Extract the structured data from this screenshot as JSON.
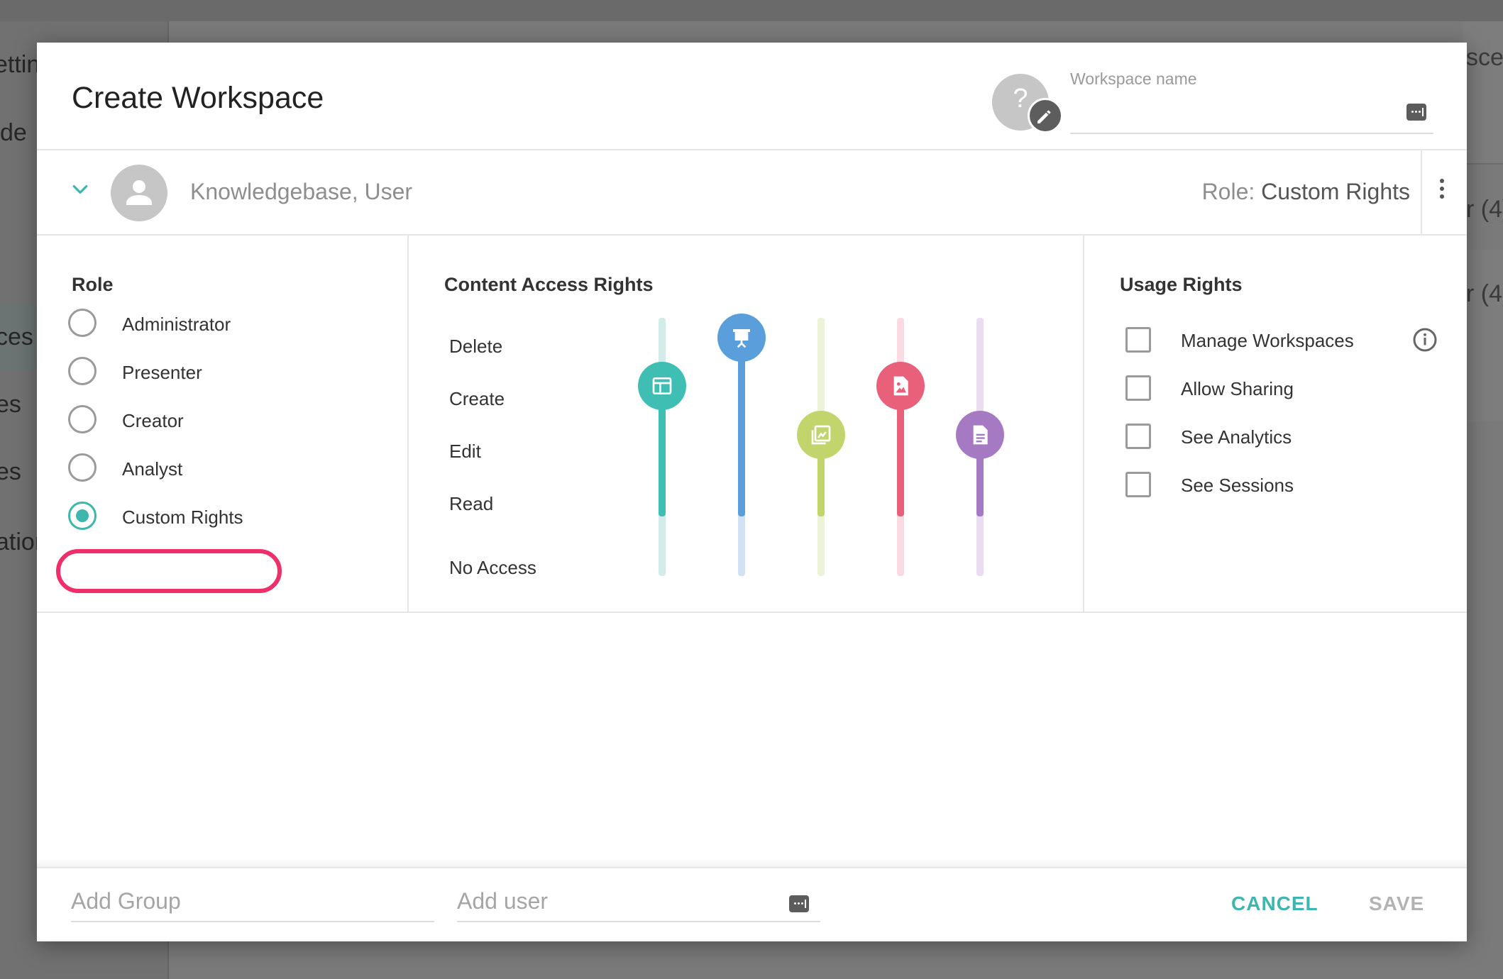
{
  "background": {
    "left_fragments": [
      "ettin",
      "de",
      "ces",
      "es",
      "es",
      "atior"
    ],
    "right_fragments": [
      "scer",
      "r (4)",
      "r (4)"
    ]
  },
  "dialog": {
    "title": "Create Workspace",
    "workspace_avatar_glyph": "?",
    "workspace_name_label": "Workspace name",
    "workspace_name_value": ""
  },
  "user": {
    "name": "Knowledgebase, User",
    "role_prefix": "Role:",
    "role_value": "Custom Rights"
  },
  "role": {
    "title": "Role",
    "options": [
      {
        "label": "Administrator",
        "checked": false
      },
      {
        "label": "Presenter",
        "checked": false
      },
      {
        "label": "Creator",
        "checked": false
      },
      {
        "label": "Analyst",
        "checked": false
      },
      {
        "label": "Custom Rights",
        "checked": true
      }
    ]
  },
  "content_access": {
    "title": "Content Access Rights",
    "levels": [
      "Delete",
      "Create",
      "Edit",
      "Read",
      "No Access"
    ],
    "sliders": [
      {
        "icon": "dashboard-icon",
        "color": "#3fbfb4",
        "level": "Create"
      },
      {
        "icon": "presentation-icon",
        "color": "#5a9fdc",
        "level": "Delete"
      },
      {
        "icon": "image-edit-icon",
        "color": "#c2d56c",
        "level": "Edit"
      },
      {
        "icon": "image-file-icon",
        "color": "#e9607a",
        "level": "Create"
      },
      {
        "icon": "document-icon",
        "color": "#a57ac2",
        "level": "Edit"
      }
    ]
  },
  "usage_rights": {
    "title": "Usage Rights",
    "items": [
      {
        "label": "Manage Workspaces",
        "checked": false,
        "info": true
      },
      {
        "label": "Allow Sharing",
        "checked": false
      },
      {
        "label": "See Analytics",
        "checked": false
      },
      {
        "label": "See Sessions",
        "checked": false
      }
    ]
  },
  "footer": {
    "add_group_placeholder": "Add Group",
    "add_user_placeholder": "Add user",
    "cancel_label": "CANCEL",
    "save_label": "SAVE"
  },
  "colors": {
    "accent": "#3db7ad",
    "highlight": "#ee2f6a"
  }
}
